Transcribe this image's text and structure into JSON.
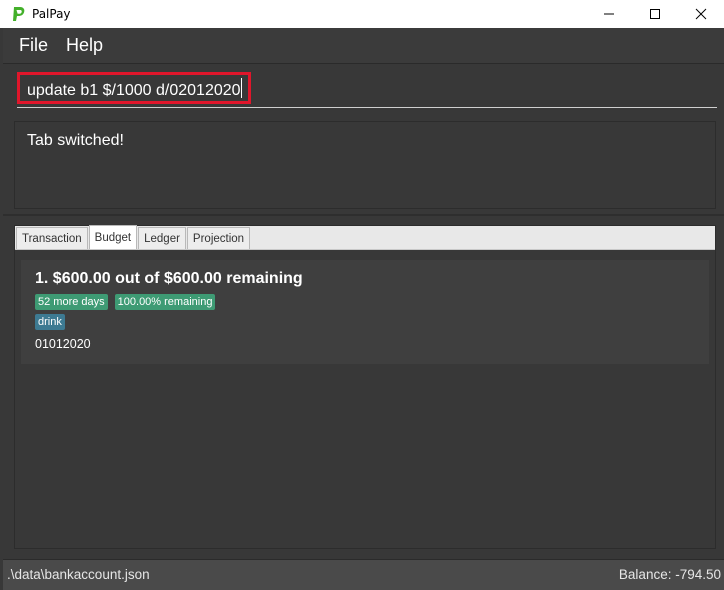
{
  "window": {
    "title": "PalPay",
    "logo_icon": "paypal-logo-icon",
    "controls": [
      "minimize-icon",
      "maximize-icon",
      "close-icon"
    ]
  },
  "menu": {
    "file": "File",
    "help": "Help"
  },
  "command": {
    "value": "update b1 $/1000 d/02012020",
    "highlight_color": "#e0162b"
  },
  "result": {
    "text": "Tab switched!"
  },
  "tabs": [
    {
      "label": "Transaction",
      "active": false
    },
    {
      "label": "Budget",
      "active": true
    },
    {
      "label": "Ledger",
      "active": false
    },
    {
      "label": "Projection",
      "active": false
    }
  ],
  "budgets": [
    {
      "title": "1.  $600.00 out of $600.00 remaining",
      "tags": [
        "52 more days",
        "100.00% remaining"
      ],
      "category": "drink",
      "date": "01012020"
    }
  ],
  "status": {
    "file_path": ".\\data\\bankaccount.json",
    "balance": "Balance: -794.50"
  },
  "colors": {
    "background": "#383838",
    "tag_green": "#3e9b74",
    "tag_blue": "#3d7a92"
  }
}
